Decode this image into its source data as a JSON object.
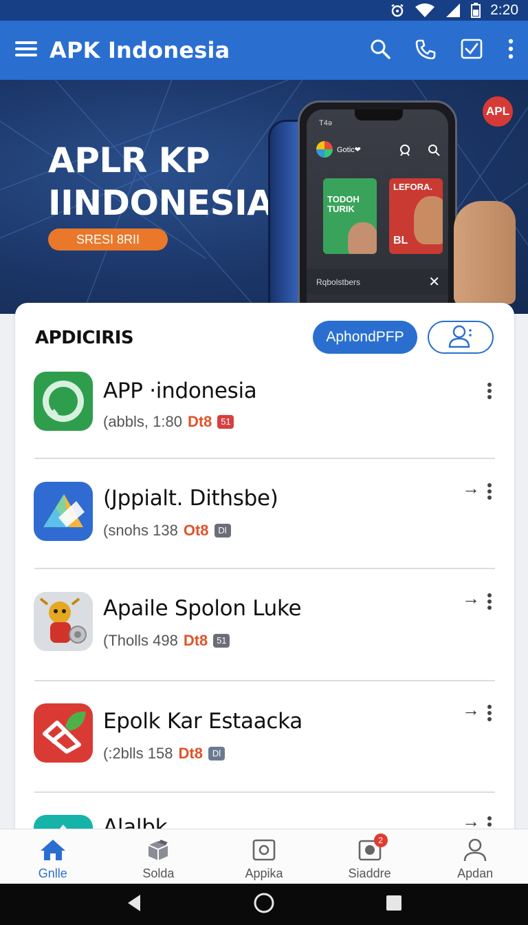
{
  "status_bar": {
    "time": "2:20"
  },
  "app_bar": {
    "title": "APK Indonesia"
  },
  "banner": {
    "title_line1": "APLR KP",
    "title_line2": "IINDONESIA",
    "button_label": "SRESI 8RII",
    "corner_badge": "APL",
    "phone": {
      "time": "T4ə",
      "app_name": "Gotic❤",
      "card1_text": "TODOH TURIK",
      "card2_text": "LEFORA.",
      "card2_sub": "BL",
      "bottom_text": "Rqbolstbers"
    }
  },
  "section": {
    "title": "APDICIRIS",
    "primary_button": "AphondPFP"
  },
  "apps": [
    {
      "name": "APP ·indonesia",
      "meta": "(abbls, 1:80",
      "tag": "Dt8",
      "badge": "51",
      "icon": "green-chat-icon",
      "show_arrow": false
    },
    {
      "name": "(Jppialt. Dithsbe)",
      "meta": "(snohs 138",
      "tag": "Ot8",
      "badge": "Dl",
      "icon": "blue-triangle-icon",
      "show_arrow": true
    },
    {
      "name": "Apaile Spolon Luke",
      "meta": "(Tholls 498",
      "tag": "Dt8",
      "badge": "51",
      "icon": "mascot-icon",
      "show_arrow": true
    },
    {
      "name": "Epolk Kar Estaacka",
      "meta": "(:2blls 158",
      "tag": "Dt8",
      "badge": "Dl",
      "icon": "red-leaf-icon",
      "show_arrow": true
    },
    {
      "name": "Alalbk",
      "meta": "",
      "tag": "",
      "badge": "",
      "icon": "teal-icon",
      "show_arrow": true
    }
  ],
  "bottom_nav": [
    {
      "label": "Gnlle",
      "icon": "home-icon",
      "active": true
    },
    {
      "label": "Solda",
      "icon": "box-icon",
      "active": false
    },
    {
      "label": "Appika",
      "icon": "apps-icon",
      "active": false
    },
    {
      "label": "Siaddre",
      "icon": "camera-icon",
      "active": false,
      "badge": "2"
    },
    {
      "label": "Apdan",
      "icon": "person-icon",
      "active": false
    }
  ],
  "colors": {
    "primary": "#2a6fd0",
    "status_bar": "#163f86",
    "accent_orange": "#e9782b",
    "badge_red": "#d63a36"
  }
}
